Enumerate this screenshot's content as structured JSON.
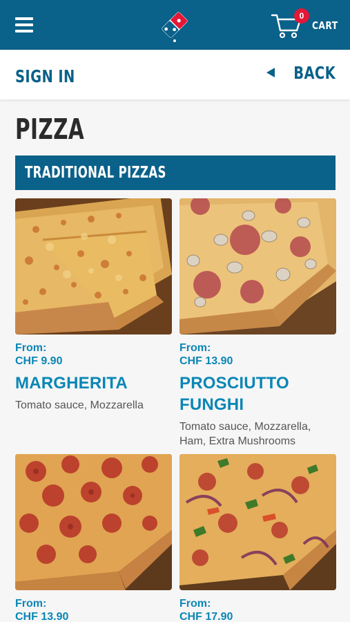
{
  "header": {
    "cart_count": "0",
    "cart_label": "CART"
  },
  "subheader": {
    "signin_label": "SIGN IN",
    "back_label": "BACK"
  },
  "page": {
    "title": "PIZZA",
    "category": "TRADITIONAL PIZZAS"
  },
  "products": [
    {
      "from_label": "From:",
      "price": "CHF 9.90",
      "name": "MARGHERITA",
      "description": "Tomato sauce, Mozzarella",
      "image": "pizza-margherita"
    },
    {
      "from_label": "From:",
      "price": "CHF 13.90",
      "name_line1": "PROSCIUTTO",
      "name_line2": "FUNGHI",
      "description_line1": "Tomato sauce, Mozzarella,",
      "description_line2": "Ham, Extra Mushrooms",
      "image": "pizza-prosciutto-funghi"
    },
    {
      "from_label": "From:",
      "price": "CHF 13.90",
      "image": "pizza-pepperoni"
    },
    {
      "from_label": "From:",
      "price": "CHF 17.90",
      "image": "pizza-vegetarian"
    }
  ],
  "colors": {
    "brand_blue": "#0a6189",
    "text_blue": "#0a86b5",
    "badge_red": "#e31837",
    "background": "#f6f6f6"
  },
  "icons": [
    "menu-icon",
    "dominos-logo-icon",
    "cart-icon",
    "back-arrow-icon"
  ]
}
